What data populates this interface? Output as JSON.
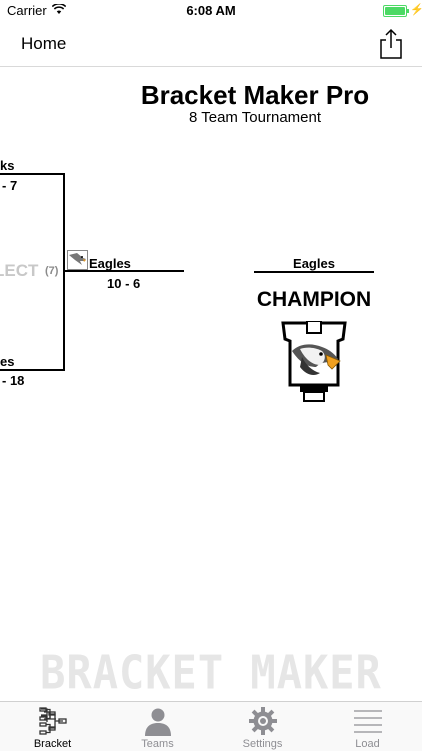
{
  "status_bar": {
    "carrier": "Carrier",
    "time": "6:08 AM"
  },
  "nav": {
    "title": "Home",
    "share_icon": "share-icon"
  },
  "header": {
    "title": "Bracket Maker Pro",
    "subtitle": "8 Team Tournament"
  },
  "bracket": {
    "left_top_team": "ks",
    "left_top_score": "- 7",
    "left_bottom_team": "es",
    "left_bottom_score": "- 18",
    "select_text": "LECT",
    "seed": "(7)",
    "winner_team": "Eagles",
    "winner_score": "10 - 6",
    "champion_team": "Eagles",
    "champion_label": "CHAMPION"
  },
  "watermark": "BRACKET MAKER",
  "tabs": [
    {
      "label": "Bracket",
      "icon": "bracket-icon",
      "active": true
    },
    {
      "label": "Teams",
      "icon": "person-icon",
      "active": false
    },
    {
      "label": "Settings",
      "icon": "gear-icon",
      "active": false
    },
    {
      "label": "Load",
      "icon": "list-icon",
      "active": false
    }
  ],
  "colors": {
    "battery": "#4cd964",
    "tab_inactive": "#8e8e93",
    "watermark": "#e6e6e6"
  }
}
